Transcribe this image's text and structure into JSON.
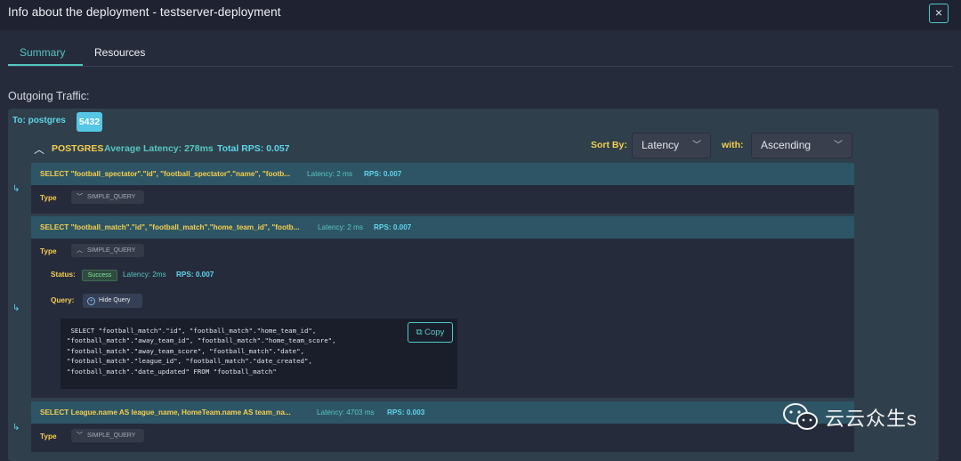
{
  "window": {
    "title": "Info about the deployment - testserver-deployment",
    "close_label": "×"
  },
  "tabs": [
    {
      "label": "Summary"
    },
    {
      "label": "Resources"
    }
  ],
  "section": {
    "title": "Outgoing Traffic:"
  },
  "target": {
    "to_label": "To: postgres",
    "port": "5432"
  },
  "service": {
    "name": "POSTGRES",
    "avg_latency": "Average Latency: 278ms",
    "total_rps": "Total RPS: 0.057"
  },
  "sort": {
    "label": "Sort By:",
    "value": "Latency",
    "with_label": "with:",
    "direction": "Ascending"
  },
  "queries": [
    {
      "sql": "SELECT \"football_spectator\".\"id\", \"football_spectator\".\"name\", \"footb...",
      "latency": "Latency: 2 ms",
      "rps": "RPS: 0.007",
      "type_label": "Type",
      "type_value": "SIMPLE_QUERY"
    },
    {
      "sql": "SELECT \"football_match\".\"id\", \"football_match\".\"home_team_id\", \"footb...",
      "latency": "Latency: 2 ms",
      "rps": "RPS: 0.007",
      "type_label": "Type",
      "type_value": "SIMPLE_QUERY",
      "details": {
        "status_label": "Status:",
        "status_value": "Success",
        "latency": "Latency: 2ms",
        "rps": "RPS: 0.007",
        "query_label": "Query:",
        "hide_label": "Hide Query",
        "copy_label": "Copy",
        "code": " SELECT \"football_match\".\"id\", \"football_match\".\"home_team_id\",\n\"football_match\".\"away_team_id\", \"football_match\".\"home_team_score\",\n\"football_match\".\"away_team_score\", \"football_match\".\"date\",\n\"football_match\".\"league_id\", \"football_match\".\"date_created\",\n\"football_match\".\"date_updated\" FROM \"football_match\""
      }
    },
    {
      "sql": "SELECT League.name AS league_name, HomeTeam.name AS team_na...",
      "latency": "Latency: 4703 ms",
      "rps": "RPS: 0.003",
      "type_label": "Type",
      "type_value": "SIMPLE_QUERY"
    }
  ],
  "watermark": {
    "text": "云云众生s"
  },
  "colors": {
    "accent": "#56c6c1",
    "yellow": "#f5cf4f",
    "cyan": "#5fd5ea",
    "background": "#262b3c",
    "panel": "#2f3f4b"
  }
}
